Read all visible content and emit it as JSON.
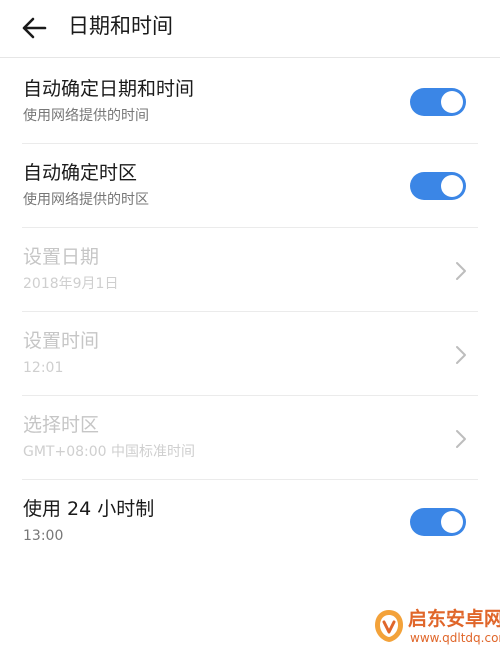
{
  "header": {
    "title": "日期和时间"
  },
  "settings": [
    {
      "title": "自动确定日期和时间",
      "subtitle": "使用网络提供的时间",
      "control": "toggle",
      "enabled": true,
      "on": true
    },
    {
      "title": "自动确定时区",
      "subtitle": "使用网络提供的时区",
      "control": "toggle",
      "enabled": true,
      "on": true
    },
    {
      "title": "设置日期",
      "subtitle": "2018年9月1日",
      "control": "chevron",
      "enabled": false
    },
    {
      "title": "设置时间",
      "subtitle": "12:01",
      "control": "chevron",
      "enabled": false
    },
    {
      "title": "选择时区",
      "subtitle": "GMT+08:00 中国标准时间",
      "control": "chevron",
      "enabled": false
    },
    {
      "title": "使用 24 小时制",
      "subtitle": "13:00",
      "control": "toggle",
      "enabled": true,
      "on": true
    }
  ],
  "watermark": {
    "name": "启东安卓网",
    "url": "www.qdltdq.com"
  },
  "icons": {
    "back": "arrow-left-icon",
    "chevron": "chevron-right-icon"
  },
  "colors": {
    "toggle_on": "#3b86e6",
    "text_primary": "#1a1a1a",
    "text_secondary": "#777777",
    "text_disabled": "#c6c6c6",
    "watermark": "#e0662a"
  }
}
